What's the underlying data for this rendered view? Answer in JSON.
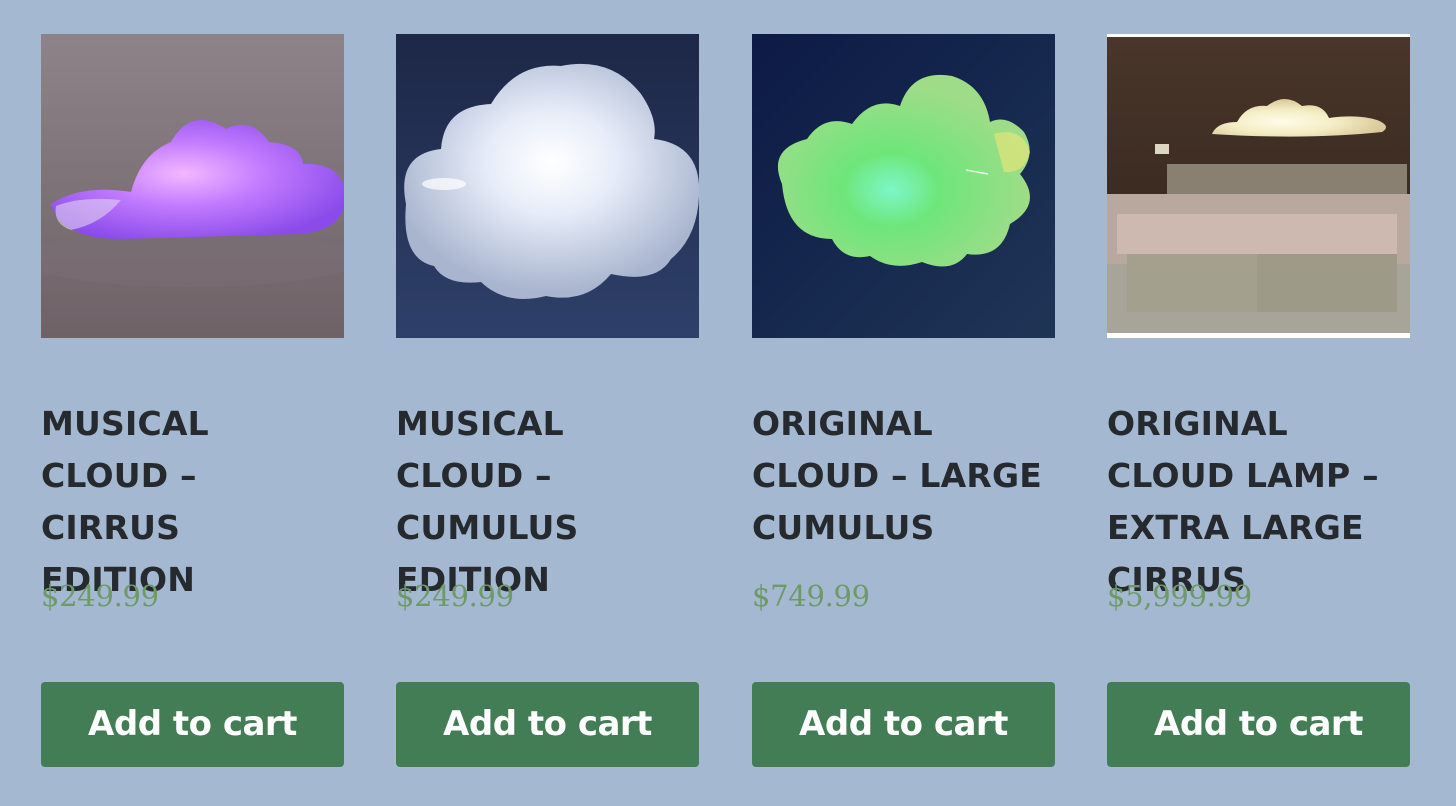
{
  "products": [
    {
      "title": "MUSICAL CLOUD – CIRRUS EDITION",
      "price": "$249.99",
      "button_label": "Add to cart",
      "image": "purple-glowing-cloud-lamp"
    },
    {
      "title": "MUSICAL CLOUD – CUMULUS EDITION",
      "price": "$249.99",
      "button_label": "Add to cart",
      "image": "white-glowing-cloud-lamp"
    },
    {
      "title": "ORIGINAL CLOUD – LARGE CUMULUS",
      "price": "$749.99",
      "button_label": "Add to cart",
      "image": "green-glowing-cloud-lamp"
    },
    {
      "title": "ORIGINAL CLOUD LAMP – EXTRA LARGE CIRRUS",
      "price": "$5,999.99",
      "button_label": "Add to cart",
      "image": "cloud-lamp-bedroom-photo"
    }
  ],
  "colors": {
    "page_background": "#a5b8d1",
    "title_text": "#262a2e",
    "price_text": "#6e9a6a",
    "button_background": "#427d55",
    "button_text": "#ffffff"
  }
}
